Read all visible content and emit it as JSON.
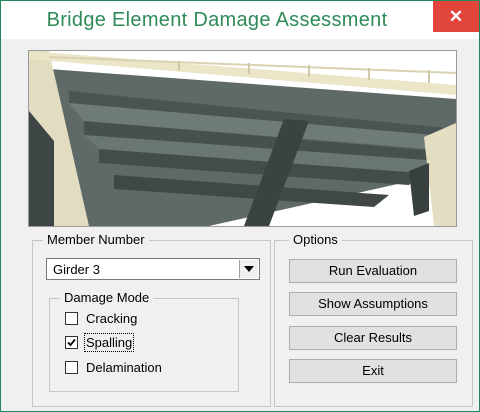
{
  "window": {
    "title": "Bridge Element Damage Assessment",
    "close_glyph": "✕"
  },
  "member": {
    "group_label": "Member Number",
    "selected": "Girder 3"
  },
  "damage_mode": {
    "group_label": "Damage Mode",
    "options": [
      {
        "label": "Cracking",
        "checked": false
      },
      {
        "label": "Spalling",
        "checked": true
      },
      {
        "label": "Delamination",
        "checked": false
      }
    ]
  },
  "options": {
    "group_label": "Options",
    "buttons": [
      "Run Evaluation",
      "Show Assumptions",
      "Clear Results",
      "Exit"
    ]
  },
  "colors": {
    "title": "#2e8b57",
    "close": "#e2453b"
  }
}
